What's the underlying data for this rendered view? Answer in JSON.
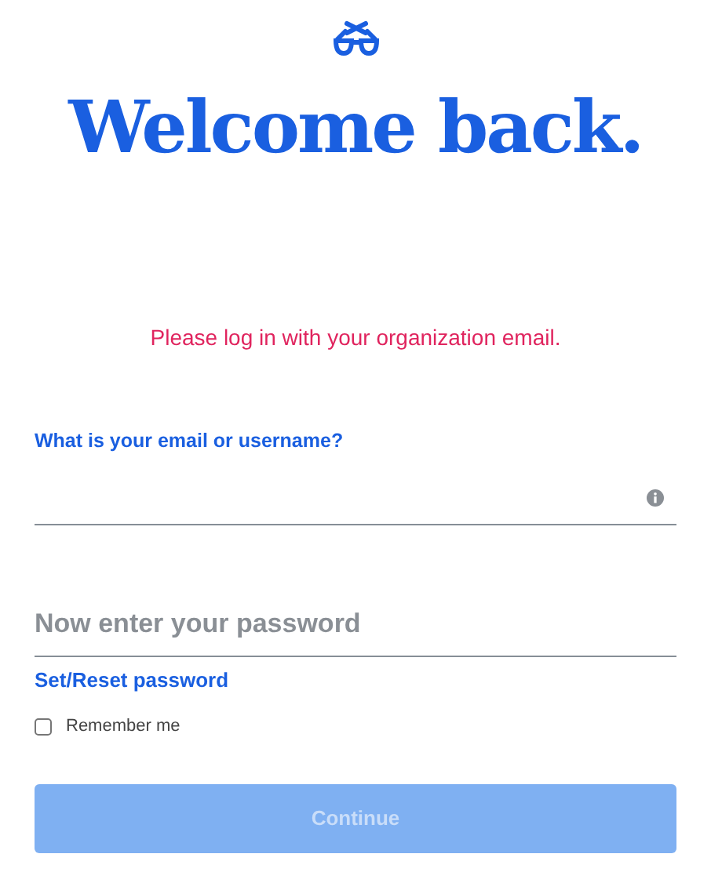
{
  "heading": "Welcome back.",
  "notice": "Please log in with your organization email.",
  "email_field": {
    "label": "What is your email or username?"
  },
  "password_field": {
    "placeholder": "Now enter your password"
  },
  "reset_link": "Set/Reset password",
  "remember_me": {
    "label": "Remember me",
    "checked": false
  },
  "continue_button": {
    "label": "Continue",
    "disabled": true
  }
}
